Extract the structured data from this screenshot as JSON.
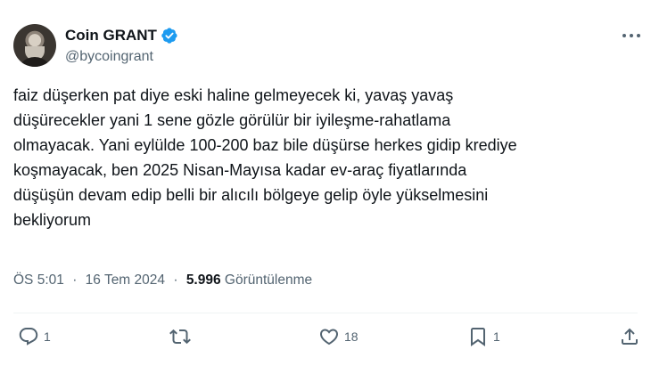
{
  "author": {
    "display_name": "Coin GRANT",
    "handle": "@bycoingrant",
    "verified": true
  },
  "tweet": {
    "text_lines": [
      "faiz düşerken pat diye eski haline gelmeyecek ki, yavaş yavaş",
      "düşürecekler yani 1 sene gözle görülür bir iyileşme-rahatlama",
      "olmayacak. Yani eylülde 100-200 baz bile düşürse herkes gidip krediye",
      "koşmayacak, ben 2025 Nisan-Mayısa kadar ev-araç fiyatlarında",
      "düşüşün devam edip belli bir alıcılı bölgeye gelip öyle yükselmesini",
      "bekliyorum"
    ],
    "time": "ÖS 5:01",
    "date": "16 Tem 2024",
    "separator": "·",
    "views_count": "5.996",
    "views_label": "Görüntülenme"
  },
  "actions": {
    "reply_count": "1",
    "retweet_count": "",
    "like_count": "18",
    "bookmark_count": "1"
  },
  "colors": {
    "text_primary": "#0f1419",
    "text_secondary": "#536471",
    "verified_badge": "#1d9bf0",
    "divider": "#eff3f4"
  },
  "icons": [
    "more-icon",
    "verified-icon",
    "reply-icon",
    "retweet-icon",
    "like-icon",
    "bookmark-icon",
    "share-icon"
  ]
}
